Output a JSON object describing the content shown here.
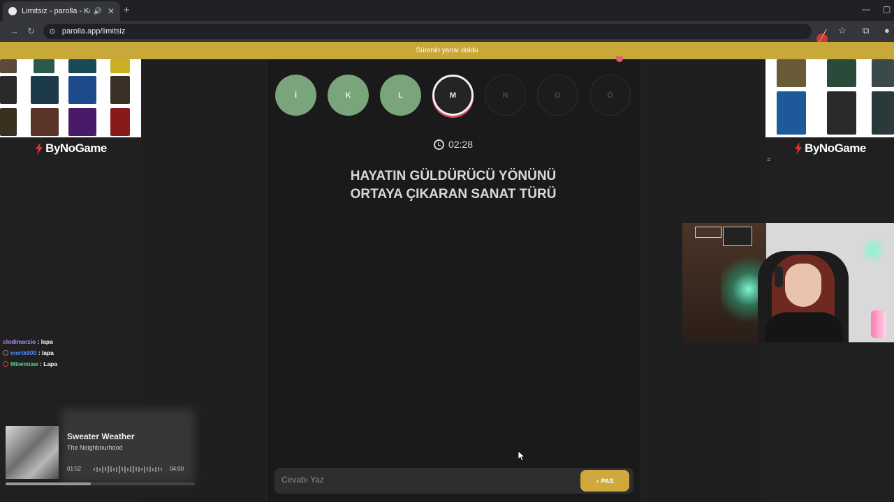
{
  "browser": {
    "tab_title": "Limitsiz - parolla - Kelime o",
    "url": "parolla.app/limitsiz",
    "icons": [
      "back-icon",
      "forward-icon",
      "reload-icon",
      "site-info-icon",
      "star-icon",
      "extensions-icon",
      "close-icon",
      "new-tab-icon",
      "minimize-icon",
      "maximize-icon"
    ]
  },
  "banner": {
    "text": "Sürenin yarısı doldu"
  },
  "sponsor": {
    "brand": "ByNoGame"
  },
  "game": {
    "letters": [
      {
        "char": "İ",
        "state": "done"
      },
      {
        "char": "K",
        "state": "done"
      },
      {
        "char": "L",
        "state": "done"
      },
      {
        "char": "M",
        "state": "active"
      },
      {
        "char": "N",
        "state": "todo"
      },
      {
        "char": "O",
        "state": "todo"
      },
      {
        "char": "Ö",
        "state": "todo"
      }
    ],
    "timer": "02:28",
    "question_line1": "HAYATIN GÜLDÜRÜCÜ YÖNÜNÜ",
    "question_line2": "ORTAYA ÇIKARAN SANAT TÜRÜ",
    "answer_placeholder": "Cevabı Yaz",
    "pass_label": "PAS"
  },
  "chat": [
    {
      "user": "clodimarzio",
      "message": "lapa",
      "color": "#b98cff"
    },
    {
      "user": "mertk900",
      "message": "lapa",
      "color": "#4a8bff"
    },
    {
      "user": "Miiwmiaw",
      "message": "Lapa",
      "color": "#59d28f"
    }
  ],
  "music": {
    "title": "Sweater Weather",
    "artist": "The Neighbourhood",
    "elapsed": "01:52",
    "duration": "04:00",
    "progress": 0.45
  },
  "colors": {
    "banner": "#c9a83a",
    "done": "#7aa57c",
    "active_ring": "#d84a5a",
    "pass_button": "#cfa93d",
    "brand_red": "#e0322f"
  }
}
